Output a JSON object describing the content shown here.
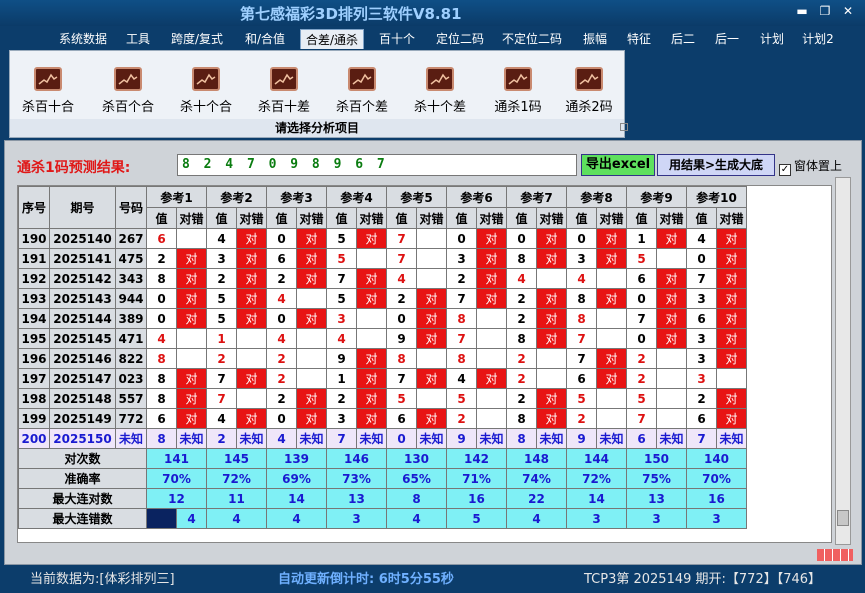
{
  "window": {
    "title": "第七感福彩3D排列三软件V8.81",
    "min": "▬",
    "restore": "❐",
    "close": "✕"
  },
  "menu": [
    "系统数据",
    "工具",
    "跨度/复式",
    "和/合值",
    "合差/通杀",
    "百十个",
    "定位二码",
    "不定位二码",
    "振幅",
    "特征",
    "后二",
    "后一",
    "计划",
    "计划2"
  ],
  "menu_active": 4,
  "ribbon": {
    "buttons": [
      "杀百十合",
      "杀百个合",
      "杀十个合",
      "杀百十差",
      "杀百个差",
      "杀十个差",
      "通杀1码",
      "通杀2码"
    ],
    "footer": "请选择分析项目"
  },
  "prediction": {
    "label": "通杀1码预测结果:",
    "value": "8 2 4 7 0 9 8 9 6 7",
    "excel_btn": "导出excel",
    "gen_btn": "用结果>生成大底",
    "topmost": "窗体置上"
  },
  "table": {
    "h_seq": "序号",
    "h_period": "期号",
    "h_num": "号码",
    "h_val": "值",
    "h_hit": "对错",
    "hit_text": "对",
    "refs": [
      "参考1",
      "参考2",
      "参考3",
      "参考4",
      "参考5",
      "参考6",
      "参考7",
      "参考8",
      "参考9",
      "参考10"
    ],
    "rows": [
      {
        "seq": "190",
        "period": "2025140",
        "num": "267",
        "cells": [
          [
            "6",
            "r",
            0
          ],
          [
            "4",
            "k",
            1
          ],
          [
            "0",
            "k",
            1
          ],
          [
            "5",
            "k",
            1
          ],
          [
            "7",
            "r",
            0
          ],
          [
            "0",
            "k",
            1
          ],
          [
            "0",
            "k",
            1
          ],
          [
            "0",
            "k",
            1
          ],
          [
            "1",
            "k",
            1
          ],
          [
            "4",
            "k",
            1
          ]
        ]
      },
      {
        "seq": "191",
        "period": "2025141",
        "num": "475",
        "cells": [
          [
            "2",
            "k",
            1
          ],
          [
            "3",
            "k",
            1
          ],
          [
            "6",
            "k",
            1
          ],
          [
            "5",
            "r",
            0
          ],
          [
            "7",
            "r",
            0
          ],
          [
            "3",
            "k",
            1
          ],
          [
            "8",
            "k",
            1
          ],
          [
            "3",
            "k",
            1
          ],
          [
            "5",
            "r",
            0
          ],
          [
            "0",
            "k",
            1
          ]
        ]
      },
      {
        "seq": "192",
        "period": "2025142",
        "num": "343",
        "cells": [
          [
            "8",
            "k",
            1
          ],
          [
            "2",
            "k",
            1
          ],
          [
            "2",
            "k",
            1
          ],
          [
            "7",
            "k",
            1
          ],
          [
            "4",
            "r",
            0
          ],
          [
            "2",
            "k",
            1
          ],
          [
            "4",
            "r",
            0
          ],
          [
            "4",
            "r",
            0
          ],
          [
            "6",
            "k",
            1
          ],
          [
            "7",
            "k",
            1
          ]
        ]
      },
      {
        "seq": "193",
        "period": "2025143",
        "num": "944",
        "cells": [
          [
            "0",
            "k",
            1
          ],
          [
            "5",
            "k",
            1
          ],
          [
            "4",
            "r",
            0
          ],
          [
            "5",
            "k",
            1
          ],
          [
            "2",
            "k",
            1
          ],
          [
            "7",
            "k",
            1
          ],
          [
            "2",
            "k",
            1
          ],
          [
            "8",
            "k",
            1
          ],
          [
            "0",
            "k",
            1
          ],
          [
            "3",
            "k",
            1
          ]
        ]
      },
      {
        "seq": "194",
        "period": "2025144",
        "num": "389",
        "cells": [
          [
            "0",
            "k",
            1
          ],
          [
            "5",
            "k",
            1
          ],
          [
            "0",
            "k",
            1
          ],
          [
            "3",
            "r",
            0
          ],
          [
            "0",
            "k",
            1
          ],
          [
            "8",
            "r",
            0
          ],
          [
            "2",
            "k",
            1
          ],
          [
            "8",
            "r",
            0
          ],
          [
            "7",
            "k",
            1
          ],
          [
            "6",
            "k",
            1
          ]
        ]
      },
      {
        "seq": "195",
        "period": "2025145",
        "num": "471",
        "cells": [
          [
            "4",
            "r",
            0
          ],
          [
            "1",
            "r",
            0
          ],
          [
            "4",
            "r",
            0
          ],
          [
            "4",
            "r",
            0
          ],
          [
            "9",
            "k",
            1
          ],
          [
            "7",
            "r",
            0
          ],
          [
            "8",
            "k",
            1
          ],
          [
            "7",
            "r",
            0
          ],
          [
            "0",
            "k",
            1
          ],
          [
            "3",
            "k",
            1
          ]
        ]
      },
      {
        "seq": "196",
        "period": "2025146",
        "num": "822",
        "cells": [
          [
            "8",
            "r",
            0
          ],
          [
            "2",
            "r",
            0
          ],
          [
            "2",
            "r",
            0
          ],
          [
            "9",
            "k",
            1
          ],
          [
            "8",
            "r",
            0
          ],
          [
            "8",
            "r",
            0
          ],
          [
            "2",
            "r",
            0
          ],
          [
            "7",
            "k",
            1
          ],
          [
            "2",
            "r",
            0
          ],
          [
            "3",
            "k",
            1
          ]
        ]
      },
      {
        "seq": "197",
        "period": "2025147",
        "num": "023",
        "cells": [
          [
            "8",
            "k",
            1
          ],
          [
            "7",
            "k",
            1
          ],
          [
            "2",
            "r",
            0
          ],
          [
            "1",
            "k",
            1
          ],
          [
            "7",
            "k",
            1
          ],
          [
            "4",
            "k",
            1
          ],
          [
            "2",
            "r",
            0
          ],
          [
            "6",
            "k",
            1
          ],
          [
            "2",
            "r",
            0
          ],
          [
            "3",
            "r",
            0
          ]
        ]
      },
      {
        "seq": "198",
        "period": "2025148",
        "num": "557",
        "cells": [
          [
            "8",
            "k",
            1
          ],
          [
            "7",
            "r",
            0
          ],
          [
            "2",
            "k",
            1
          ],
          [
            "2",
            "k",
            1
          ],
          [
            "5",
            "r",
            0
          ],
          [
            "5",
            "r",
            0
          ],
          [
            "2",
            "k",
            1
          ],
          [
            "5",
            "r",
            0
          ],
          [
            "5",
            "r",
            0
          ],
          [
            "2",
            "k",
            1
          ]
        ]
      },
      {
        "seq": "199",
        "period": "2025149",
        "num": "772",
        "cells": [
          [
            "6",
            "k",
            1
          ],
          [
            "4",
            "k",
            1
          ],
          [
            "0",
            "k",
            1
          ],
          [
            "3",
            "k",
            1
          ],
          [
            "6",
            "k",
            1
          ],
          [
            "2",
            "r",
            0
          ],
          [
            "8",
            "k",
            1
          ],
          [
            "2",
            "r",
            0
          ],
          [
            "7",
            "r",
            0
          ],
          [
            "6",
            "k",
            1
          ]
        ]
      }
    ],
    "pred_row": {
      "seq": "200",
      "period": "2025150",
      "num": "未知",
      "vals": [
        "8",
        "2",
        "4",
        "7",
        "0",
        "9",
        "8",
        "9",
        "6",
        "7"
      ],
      "unknown": "未知"
    },
    "stats": [
      {
        "label": "对次数",
        "vals": [
          "141",
          "145",
          "139",
          "146",
          "130",
          "142",
          "148",
          "144",
          "150",
          "140"
        ]
      },
      {
        "label": "准确率",
        "vals": [
          "70%",
          "72%",
          "69%",
          "73%",
          "65%",
          "71%",
          "74%",
          "72%",
          "75%",
          "70%"
        ]
      },
      {
        "label": "最大连对数",
        "vals": [
          "12",
          "11",
          "14",
          "13",
          "8",
          "16",
          "22",
          "14",
          "13",
          "16"
        ]
      },
      {
        "label": "最大连错数",
        "vals": [
          "4",
          "4",
          "4",
          "3",
          "4",
          "5",
          "4",
          "3",
          "3",
          "3"
        ]
      }
    ]
  },
  "status": {
    "source": "当前数据为:[体彩排列三]",
    "countdown": "自动更新倒计时: 6时5分55秒",
    "draw": "TCP3第 2025149 期开:【772】【746】"
  },
  "colors": {
    "hit": "#e81414",
    "stat_bg": "#7ff0f5",
    "pred_text": "#1a1ad0",
    "title": "#9fd0ff"
  }
}
